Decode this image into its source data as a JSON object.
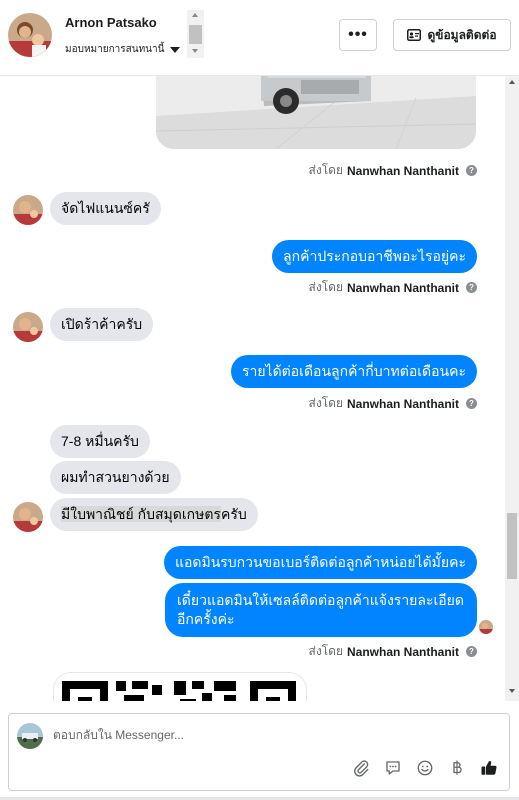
{
  "header": {
    "contact_name": "Arnon Patsako",
    "assign_label": "มอบหมายการสนทนานี้",
    "more_label": "•••",
    "contact_info_label": "ดูข้อมูลติดต่อ"
  },
  "messages": {
    "sent_by_prefix": "ส่งโดย",
    "sender_name": "Nanwhan Nanthanit",
    "help_glyph": "?",
    "m1": "จัดไฟแนนซ์ครั",
    "m2": "ลูกค้าประกอบอาชีพอะไรอยู่คะ",
    "m3": "เปิดร้าค้าครับ",
    "m4": "รายได้ต่อเดือนลูกค้ากี่บาทต่อเดือนคะ",
    "m5": "7-8 หมื่นครับ",
    "m6": "ผมทำสวนยางด้วย",
    "m7_selected": "มีใบพาณิชย์ กับสมุดเกษตร",
    "m7_rest": "ครับ",
    "m8": "แอดมินรบกวนขอเบอร์ติดต่อลูกค้าหน่อยได้มั้ยคะ",
    "m9": "เดี๋ยวแอดมินให้เซลล์ติดต่อลูกค้าแจ้งรายละเอียดอีกครั้งค่ะ"
  },
  "composer": {
    "placeholder": "ตอบกลับใน Messenger..."
  },
  "icons": {
    "attach": "paperclip-icon",
    "saved_reply": "speech-bubble-icon",
    "emoji": "smiley-icon",
    "payment": "baht-icon",
    "like": "thumbs-up-icon"
  },
  "colors": {
    "outgoing_bubble": "#0084ff",
    "incoming_bubble": "#e4e6eb"
  }
}
